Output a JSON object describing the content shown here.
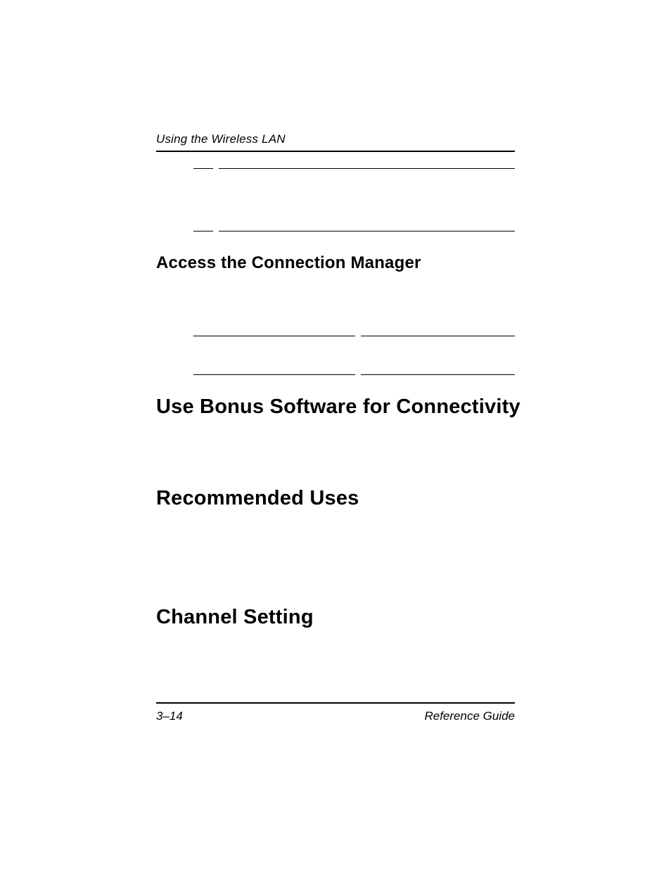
{
  "header": {
    "running_title": "Using the Wireless LAN"
  },
  "headings": {
    "access_connection_manager": "Access the Connection Manager",
    "use_bonus_software": "Use Bonus Software for Connectivity",
    "recommended_uses": "Recommended Uses",
    "channel_setting": "Channel Setting"
  },
  "footer": {
    "page_number": "3–14",
    "doc_title": "Reference Guide"
  }
}
